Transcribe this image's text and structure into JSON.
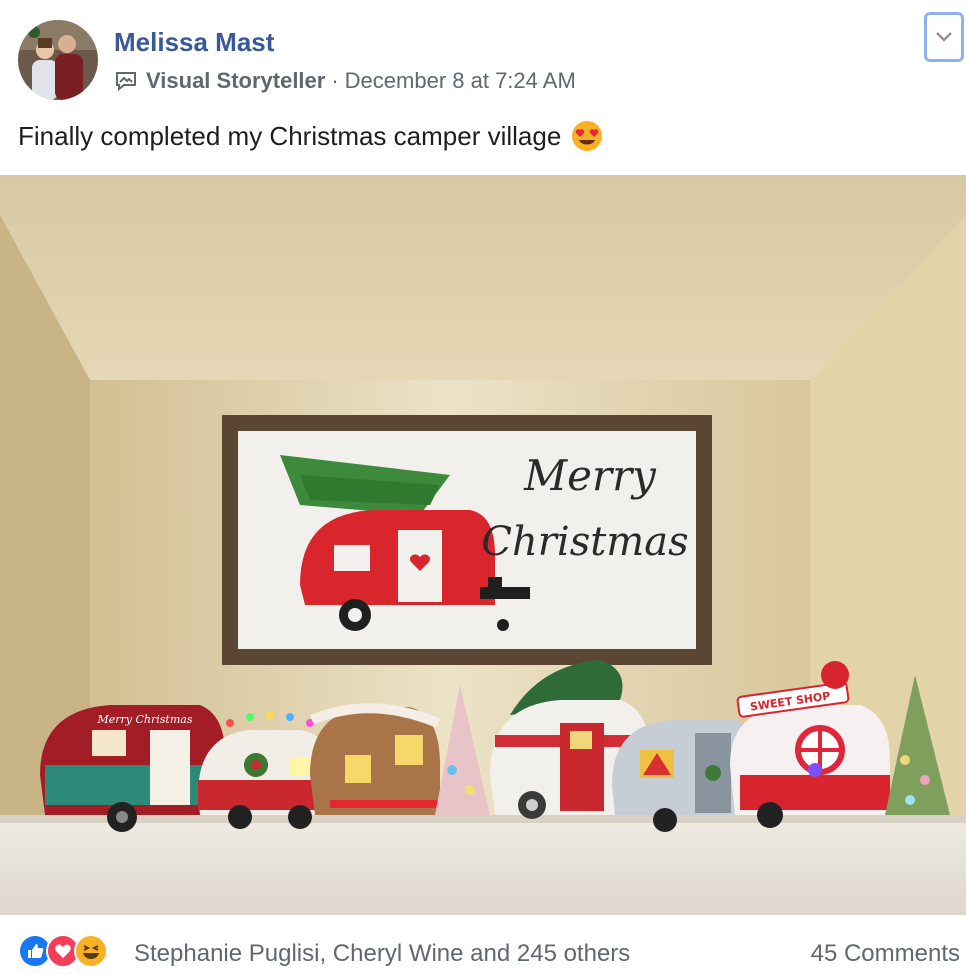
{
  "post": {
    "author": "Melissa Mast",
    "badge": "Visual Storyteller",
    "separator": "·",
    "timestamp": "December 8 at 7:24 AM",
    "text": "Finally completed my Christmas camper village",
    "text_emoji": "heart-eyes-emoji"
  },
  "photo": {
    "sign_line1": "Merry",
    "sign_line2": "Christmas",
    "camper_left_label": "Merry Christmas",
    "camper_right_label": "SWEET SHOP"
  },
  "footer": {
    "reaction_icons": [
      "like-icon",
      "love-icon",
      "haha-icon"
    ],
    "reactors": "Stephanie Puglisi, Cheryl Wine and 245 others",
    "comments": "45 Comments"
  },
  "colors": {
    "link": "#385898",
    "meta": "#606770",
    "text": "#1c1e21",
    "like": "#1877f2",
    "love": "#f33e58",
    "haha": "#f7b125"
  }
}
